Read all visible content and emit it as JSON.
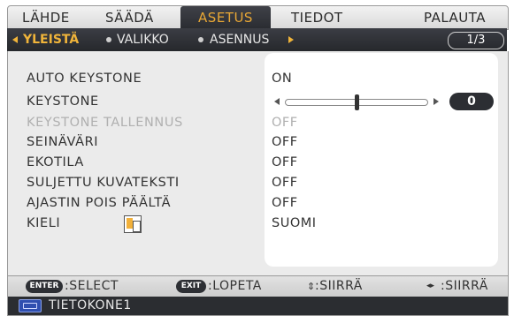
{
  "tabs": [
    {
      "label": "LÄHDE",
      "active": false
    },
    {
      "label": "SÄÄDÄ",
      "active": false
    },
    {
      "label": "ASETUS",
      "active": true
    },
    {
      "label": "TIEDOT",
      "active": false
    },
    {
      "label": "PALAUTA",
      "active": false
    }
  ],
  "subtabs": {
    "items": [
      {
        "label": "YLEISTÄ",
        "active": true
      },
      {
        "label": "VALIKKO",
        "active": false
      },
      {
        "label": "ASENNUS",
        "active": false
      }
    ],
    "page": "1/3"
  },
  "settings": [
    {
      "label": "AUTO KEYSTONE",
      "value": "ON",
      "enabled": true
    },
    {
      "label": "KEYSTONE",
      "value": "0",
      "enabled": true,
      "slider_fraction": 0.5
    },
    {
      "label": "KEYSTONE TALLENNUS",
      "value": "OFF",
      "enabled": false
    },
    {
      "label": "SEINÄVÄRI",
      "value": "OFF",
      "enabled": true
    },
    {
      "label": "EKOTILA",
      "value": "OFF",
      "enabled": true
    },
    {
      "label": "SULJETTU KUVATEKSTI",
      "value": "OFF",
      "enabled": true
    },
    {
      "label": "AJASTIN POIS PÄÄLTÄ",
      "value": "OFF",
      "enabled": true
    },
    {
      "label": "KIELI",
      "value": "SUOMI",
      "enabled": true
    }
  ],
  "footer": {
    "enter_key": "ENTER",
    "enter_label": ":SELECT",
    "exit_key": "EXIT",
    "exit_label": ":LOPETA",
    "updown_icon": "⇕",
    "updown_label": ":SIIRRÄ",
    "leftright_icon": "◂▸",
    "leftright_label": ":SIIRRÄ"
  },
  "source": {
    "label": "TIETOKONE1",
    "icon": "computer-vga-icon"
  },
  "colors": {
    "accent": "#f0b43a",
    "bar": "#2a2c31"
  }
}
